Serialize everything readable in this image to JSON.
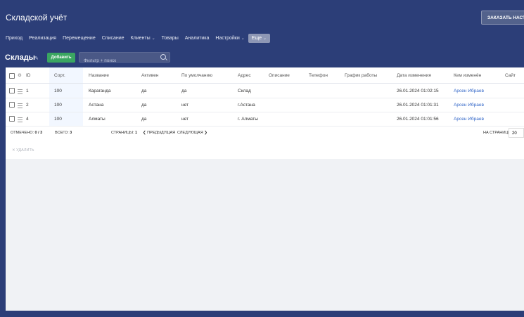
{
  "app": {
    "title": "Складской учёт",
    "header_button": "ЗАКАЗАТЬ НАСТРОЙКУ"
  },
  "nav": {
    "items": [
      "Приход",
      "Реализация",
      "Перемещение",
      "Списание",
      "Клиенты",
      "Товары",
      "Аналитика",
      "Настройки"
    ],
    "more": "Еще"
  },
  "page": {
    "title": "Склады",
    "add_button": "Добавить",
    "search_placeholder": "Фильтр + поиск"
  },
  "table": {
    "columns": [
      "ID",
      "Сорт.",
      "Название",
      "Активен",
      "По умолчанию",
      "Адрес",
      "Описание",
      "Телефон",
      "График работы",
      "Дата изменения",
      "Кем изменён",
      "Сайт"
    ],
    "rows": [
      {
        "id": "1",
        "sort": "100",
        "name": "Караганда",
        "active": "да",
        "default": "да",
        "address": "Склад",
        "date": "26.01.2024 01:02:15",
        "user": "Арсен Ибраев"
      },
      {
        "id": "2",
        "sort": "100",
        "name": "Астана",
        "active": "да",
        "default": "нет",
        "address": "г.Астана",
        "date": "26.01.2024 01:01:31",
        "user": "Арсен Ибраев"
      },
      {
        "id": "4",
        "sort": "100",
        "name": "Алматы",
        "active": "да",
        "default": "нет",
        "address": "г. Алматы",
        "date": "26.01.2024 01:01:56",
        "user": "Арсен Ибраев"
      }
    ]
  },
  "footer": {
    "selected_label": "ОТМЕЧЕНО:",
    "selected_value": "0 / 3",
    "total_label": "ВСЕГО:",
    "total_value": "3",
    "pages_label": "СТРАНИЦЫ:",
    "pages_value": "1",
    "prev": "ПРЕДЫДУЩАЯ",
    "next": "СЛЕДУЮЩАЯ",
    "per_page_label": "НА СТРАНИЦЕ:",
    "per_page_value": "20",
    "delete": "УДАЛИТЬ"
  }
}
